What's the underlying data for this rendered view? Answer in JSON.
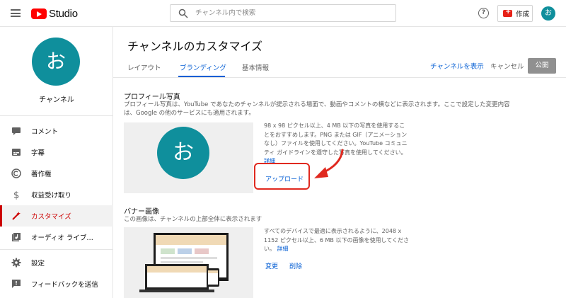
{
  "header": {
    "logo_text": "Studio",
    "search_placeholder": "チャンネル内で検索",
    "create_label": "作成",
    "avatar_initial": "お",
    "help_symbol": "?"
  },
  "sidebar": {
    "avatar_initial": "お",
    "channel_name": "チャンネル",
    "items": [
      {
        "label": "コメント",
        "icon": "comment-icon"
      },
      {
        "label": "字幕",
        "icon": "subtitles-icon"
      },
      {
        "label": "著作権",
        "icon": "copyright-icon"
      },
      {
        "label": "収益受け取り",
        "icon": "dollar-icon"
      },
      {
        "label": "カスタマイズ",
        "icon": "magic-wand-icon",
        "active": true
      },
      {
        "label": "オーディオ ライブ…",
        "icon": "audio-library-icon"
      },
      {
        "label": "設定",
        "icon": "gear-icon"
      },
      {
        "label": "フィードバックを送信",
        "icon": "feedback-icon"
      }
    ]
  },
  "main": {
    "title": "チャンネルのカスタマイズ",
    "tabs": [
      {
        "label": "レイアウト"
      },
      {
        "label": "ブランディング",
        "active": true
      },
      {
        "label": "基本情報"
      }
    ],
    "view_channel": "チャンネルを表示",
    "cancel": "キャンセル",
    "publish": "公開",
    "profile": {
      "title": "プロフィール写真",
      "desc": "プロフィール写真は、YouTube であなたのチャンネルが提示される場面で、動画やコメントの横などに表示されます。ここで設定した変更内容は、Google の他のサービスにも適用されます。",
      "avatar_initial": "お",
      "info": "98 x 98 ピクセル以上、4 MB 以下の写真を使用することをおすすめします。PNG または GIF（アニメーションなし）ファイルを使用してください。YouTube コミュニティ ガイドラインを遵守した写真を使用してください。",
      "details_link": "詳細",
      "upload": "アップロード"
    },
    "banner": {
      "title": "バナー画像",
      "desc": "この画像は、チャンネルの上部全体に表示されます",
      "info": "すべてのデバイスで最適に表示されるように、2048 x 1152 ピクセル以上、6 MB 以下の画像を使用してください。",
      "details_link": "詳細",
      "change": "変更",
      "delete": "削除"
    }
  },
  "colors": {
    "accent_blue": "#065fd4",
    "active_red": "#cc0000",
    "avatar_teal": "#0f8f9c",
    "highlight_red": "#e0291f"
  }
}
